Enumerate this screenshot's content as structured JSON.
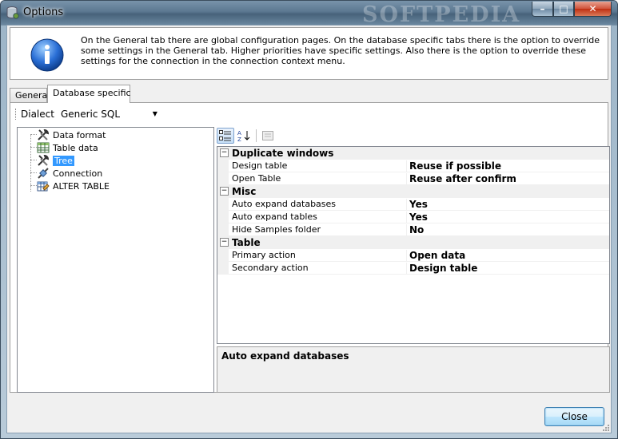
{
  "window": {
    "title": "Options",
    "watermark": "SOFTPEDIA",
    "controls": {
      "minimize": "–",
      "maximize": "□",
      "close": "✕"
    }
  },
  "info": {
    "icon": "info-icon",
    "text": "On the General tab there are global configuration pages. On the database specific tabs there is the option to override some settings in the General tab. Higher priorities have specific settings. Also there is the option to override these settings for the connection in the connection context menu."
  },
  "tabs": [
    {
      "label": "General",
      "active": false
    },
    {
      "label": "Database specific",
      "active": true
    }
  ],
  "dialect": {
    "label": "Dialect",
    "value": "Generic SQL"
  },
  "tree": {
    "items": [
      {
        "label": "Data format",
        "icon": "tools-icon",
        "selected": false
      },
      {
        "label": "Table data",
        "icon": "table-grid-icon",
        "selected": false
      },
      {
        "label": "Tree",
        "icon": "tools-icon",
        "selected": true
      },
      {
        "label": "Connection",
        "icon": "connection-icon",
        "selected": false
      },
      {
        "label": "ALTER TABLE",
        "icon": "alter-table-icon",
        "selected": false
      }
    ]
  },
  "propgrid": {
    "toolbar": [
      "categorized-icon",
      "alphabetical-sort-icon",
      "property-pages-icon"
    ],
    "sections": [
      {
        "name": "Duplicate windows",
        "expander": "⊟",
        "rows": [
          {
            "name": "Design table",
            "value": "Reuse if possible"
          },
          {
            "name": "Open Table",
            "value": "Reuse after confirm"
          }
        ]
      },
      {
        "name": "Misc",
        "expander": "⊟",
        "rows": [
          {
            "name": "Auto expand databases",
            "value": "Yes"
          },
          {
            "name": "Auto expand tables",
            "value": "Yes"
          },
          {
            "name": "Hide Samples folder",
            "value": "No"
          }
        ]
      },
      {
        "name": "Table",
        "expander": "⊟",
        "rows": [
          {
            "name": "Primary action",
            "value": "Open data"
          },
          {
            "name": "Secondary action",
            "value": "Design table"
          }
        ]
      }
    ],
    "description_title": "Auto expand databases"
  },
  "footer": {
    "close_label": "Close"
  },
  "colors": {
    "selection": "#3399ff",
    "category_bg": "#f0f0f0",
    "title_gradient": "#5c7891"
  }
}
